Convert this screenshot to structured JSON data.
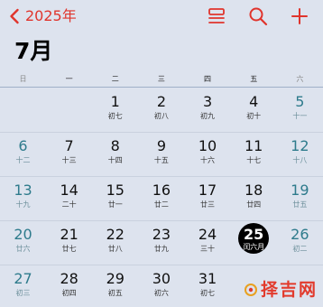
{
  "header": {
    "back_label": "2025年",
    "month_title": "7月"
  },
  "colors": {
    "accent": "#e0342c",
    "weekend": "#2e7b8c",
    "today_bg": "#000000",
    "background": "#dde3ee"
  },
  "toolbar": {
    "icons": [
      "list-view-icon",
      "search-icon",
      "add-icon"
    ]
  },
  "weekdays": [
    "日",
    "一",
    "二",
    "三",
    "四",
    "五",
    "六"
  ],
  "weeks": [
    [
      null,
      null,
      {
        "day": "1",
        "lunar": "初七"
      },
      {
        "day": "2",
        "lunar": "初八"
      },
      {
        "day": "3",
        "lunar": "初九"
      },
      {
        "day": "4",
        "lunar": "初十"
      },
      {
        "day": "5",
        "lunar": "十一"
      }
    ],
    [
      {
        "day": "6",
        "lunar": "十二"
      },
      {
        "day": "7",
        "lunar": "十三"
      },
      {
        "day": "8",
        "lunar": "十四"
      },
      {
        "day": "9",
        "lunar": "十五"
      },
      {
        "day": "10",
        "lunar": "十六"
      },
      {
        "day": "11",
        "lunar": "十七"
      },
      {
        "day": "12",
        "lunar": "十八"
      }
    ],
    [
      {
        "day": "13",
        "lunar": "十九"
      },
      {
        "day": "14",
        "lunar": "二十"
      },
      {
        "day": "15",
        "lunar": "廿一"
      },
      {
        "day": "16",
        "lunar": "廿二"
      },
      {
        "day": "17",
        "lunar": "廿三"
      },
      {
        "day": "18",
        "lunar": "廿四"
      },
      {
        "day": "19",
        "lunar": "廿五"
      }
    ],
    [
      {
        "day": "20",
        "lunar": "廿六"
      },
      {
        "day": "21",
        "lunar": "廿七"
      },
      {
        "day": "22",
        "lunar": "廿八"
      },
      {
        "day": "23",
        "lunar": "廿九"
      },
      {
        "day": "24",
        "lunar": "三十"
      },
      {
        "day": "25",
        "lunar": "闰六月",
        "today": true
      },
      {
        "day": "26",
        "lunar": "初二"
      }
    ],
    [
      {
        "day": "27",
        "lunar": "初三"
      },
      {
        "day": "28",
        "lunar": "初四"
      },
      {
        "day": "29",
        "lunar": "初五"
      },
      {
        "day": "30",
        "lunar": "初六"
      },
      {
        "day": "31",
        "lunar": "初七"
      },
      null,
      null
    ]
  ],
  "watermark": {
    "text": "择吉网"
  }
}
